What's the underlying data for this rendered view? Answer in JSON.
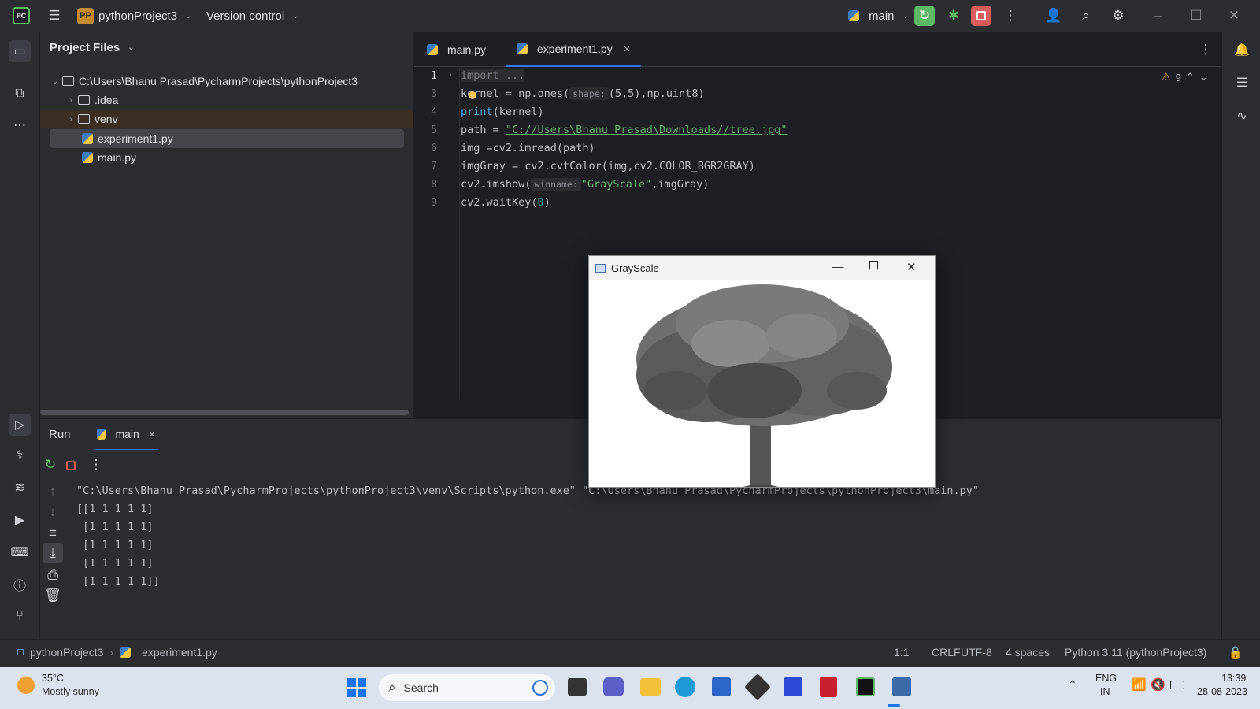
{
  "titlebar": {
    "project_badge": "PP",
    "project_name": "pythonProject3",
    "vcs": "Version control",
    "run_config": "main"
  },
  "project_panel": {
    "title": "Project Files",
    "items": [
      {
        "label": "C:\\Users\\Bhanu Prasad\\PycharmProjects\\pythonProject3",
        "kind": "folder-open"
      },
      {
        "label": ".idea",
        "kind": "folder"
      },
      {
        "label": "venv",
        "kind": "folder"
      },
      {
        "label": "experiment1.py",
        "kind": "python-file",
        "selected": true
      },
      {
        "label": "main.py",
        "kind": "python-file"
      }
    ]
  },
  "editor": {
    "tabs": [
      {
        "label": "main.py",
        "active": false
      },
      {
        "label": "experiment1.py",
        "active": true,
        "close": "×"
      }
    ],
    "warnings": "9",
    "line_numbers": [
      "1",
      "3",
      "4",
      "5",
      "6",
      "7",
      "8",
      "9"
    ],
    "code": {
      "l1": "import ...",
      "l3a": "kernel = np.ones(",
      "l3hint": "shape:",
      "l3b": "(5,5),np.uint8)",
      "l4a": "print",
      "l4b": "(kernel)",
      "l5a": "path = ",
      "l5s": "\"C://Users\\Bhanu Prasad\\Downloads//tree.jpg\"",
      "l6": "img =cv2.imread(path)",
      "l7": "imgGray = cv2.cvtColor(img,cv2.COLOR_BGR2GRAY)",
      "l8a": "cv2.imshow(",
      "l8hint": "winname:",
      "l8s": "\"GrayScale\"",
      "l8b": ",imgGray)",
      "l9a": "cv2.waitKey(",
      "l9n": "0",
      "l9b": ")"
    }
  },
  "run_panel": {
    "title": "Run",
    "tab": "main",
    "tab_close": "×",
    "output": [
      "\"C:\\Users\\Bhanu Prasad\\PycharmProjects\\pythonProject3\\venv\\Scripts\\python.exe\" \"C:\\Users\\Bhanu Prasad\\PycharmProjects\\pythonProject3\\main.py\"",
      "[[1 1 1 1 1]",
      " [1 1 1 1 1]",
      " [1 1 1 1 1]",
      " [1 1 1 1 1]",
      " [1 1 1 1 1]]"
    ]
  },
  "grayscale_window": {
    "title": "GrayScale"
  },
  "statusbar": {
    "breadcrumb_project": "pythonProject3",
    "breadcrumb_file": "experiment1.py",
    "position": "1:1",
    "line_sep": "CRLF",
    "encoding": "UTF-8",
    "indent": "4 spaces",
    "interpreter": "Python 3.11 (pythonProject3)"
  },
  "taskbar": {
    "weather_temp": "35°C",
    "weather_desc": "Mostly sunny",
    "search": "Search",
    "lang1": "ENG",
    "lang2": "IN",
    "time": "13:39",
    "date": "28-08-2023"
  },
  "colors": {
    "accent_green": "#5fb865",
    "stop_red": "#db5c5c",
    "selection": "#43454a"
  }
}
